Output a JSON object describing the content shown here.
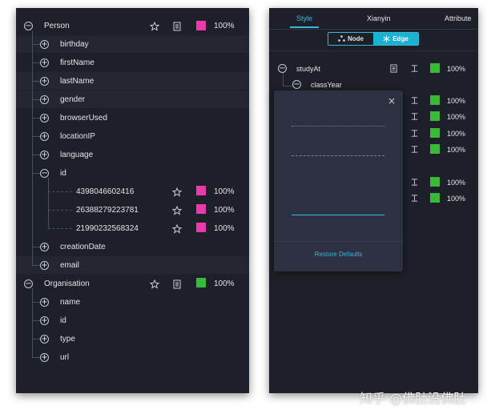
{
  "left_tree": {
    "person": {
      "label": "Person",
      "toggle": "−",
      "percent": "100%",
      "color": "#e83aa9",
      "children": [
        {
          "label": "birthday",
          "toggle": "+"
        },
        {
          "label": "firstName",
          "toggle": "+"
        },
        {
          "label": "lastName",
          "toggle": "+"
        },
        {
          "label": "gender",
          "toggle": "+"
        },
        {
          "label": "browserUsed",
          "toggle": "+"
        },
        {
          "label": "locationIP",
          "toggle": "+"
        },
        {
          "label": "language",
          "toggle": "+"
        },
        {
          "label": "id",
          "toggle": "−"
        },
        {
          "label": "creationDate",
          "toggle": "+"
        },
        {
          "label": "email",
          "toggle": "+"
        }
      ],
      "id_values": [
        {
          "label": "4398046602416",
          "percent": "100%",
          "color": "#e83aa9"
        },
        {
          "label": "26388279223781",
          "percent": "100%",
          "color": "#e83aa9"
        },
        {
          "label": "21990232568324",
          "percent": "100%",
          "color": "#e83aa9"
        }
      ]
    },
    "organisation": {
      "label": "Organisation",
      "toggle": "−",
      "percent": "100%",
      "color": "#3ab83a",
      "children": [
        {
          "label": "name",
          "toggle": "+"
        },
        {
          "label": "id",
          "toggle": "+"
        },
        {
          "label": "type",
          "toggle": "+"
        },
        {
          "label": "url",
          "toggle": "+"
        }
      ]
    }
  },
  "right_panel": {
    "tabs": [
      {
        "label": "Style",
        "active": true
      },
      {
        "label": "Xianyin",
        "active": false
      },
      {
        "label": "Attribute",
        "active": false
      }
    ],
    "mode_toggle": {
      "node_label": "Node",
      "edge_label": "Edge",
      "selected": "Edge"
    },
    "edge_tree": {
      "root": {
        "label": "studyAt",
        "toggle": "−",
        "percent": "100%",
        "color": "#3ab83a"
      },
      "child": {
        "label": "classYear",
        "toggle": "−"
      },
      "rows": [
        {
          "percent": "100%",
          "color": "#3ab83a"
        },
        {
          "percent": "100%",
          "color": "#3ab83a"
        },
        {
          "percent": "100%",
          "color": "#3ab83a"
        },
        {
          "percent": "100%",
          "color": "#3ab83a"
        },
        {
          "percent": "100%",
          "color": "#3ab83a"
        },
        {
          "percent": "100%",
          "color": "#3ab83a"
        }
      ]
    },
    "line_style_popup": {
      "close_symbol": "×",
      "line_options": [
        "dotted",
        "dashed",
        "long-dashed",
        "solid"
      ],
      "selected_option": "solid",
      "restore_label": "Restore Defaults"
    }
  },
  "watermark": "知乎 @佛肚没佛肚",
  "colors": {
    "accent": "#3ab8d8",
    "pink": "#e83aa9",
    "green": "#3ab83a",
    "panel_bg": "#1e2029",
    "popup_bg": "#2c3040"
  },
  "icons": {
    "star": "star-icon",
    "document": "document-icon",
    "edge_style": "edge-style-icon",
    "close": "close-icon",
    "node": "node-icon",
    "edge": "edge-icon"
  }
}
